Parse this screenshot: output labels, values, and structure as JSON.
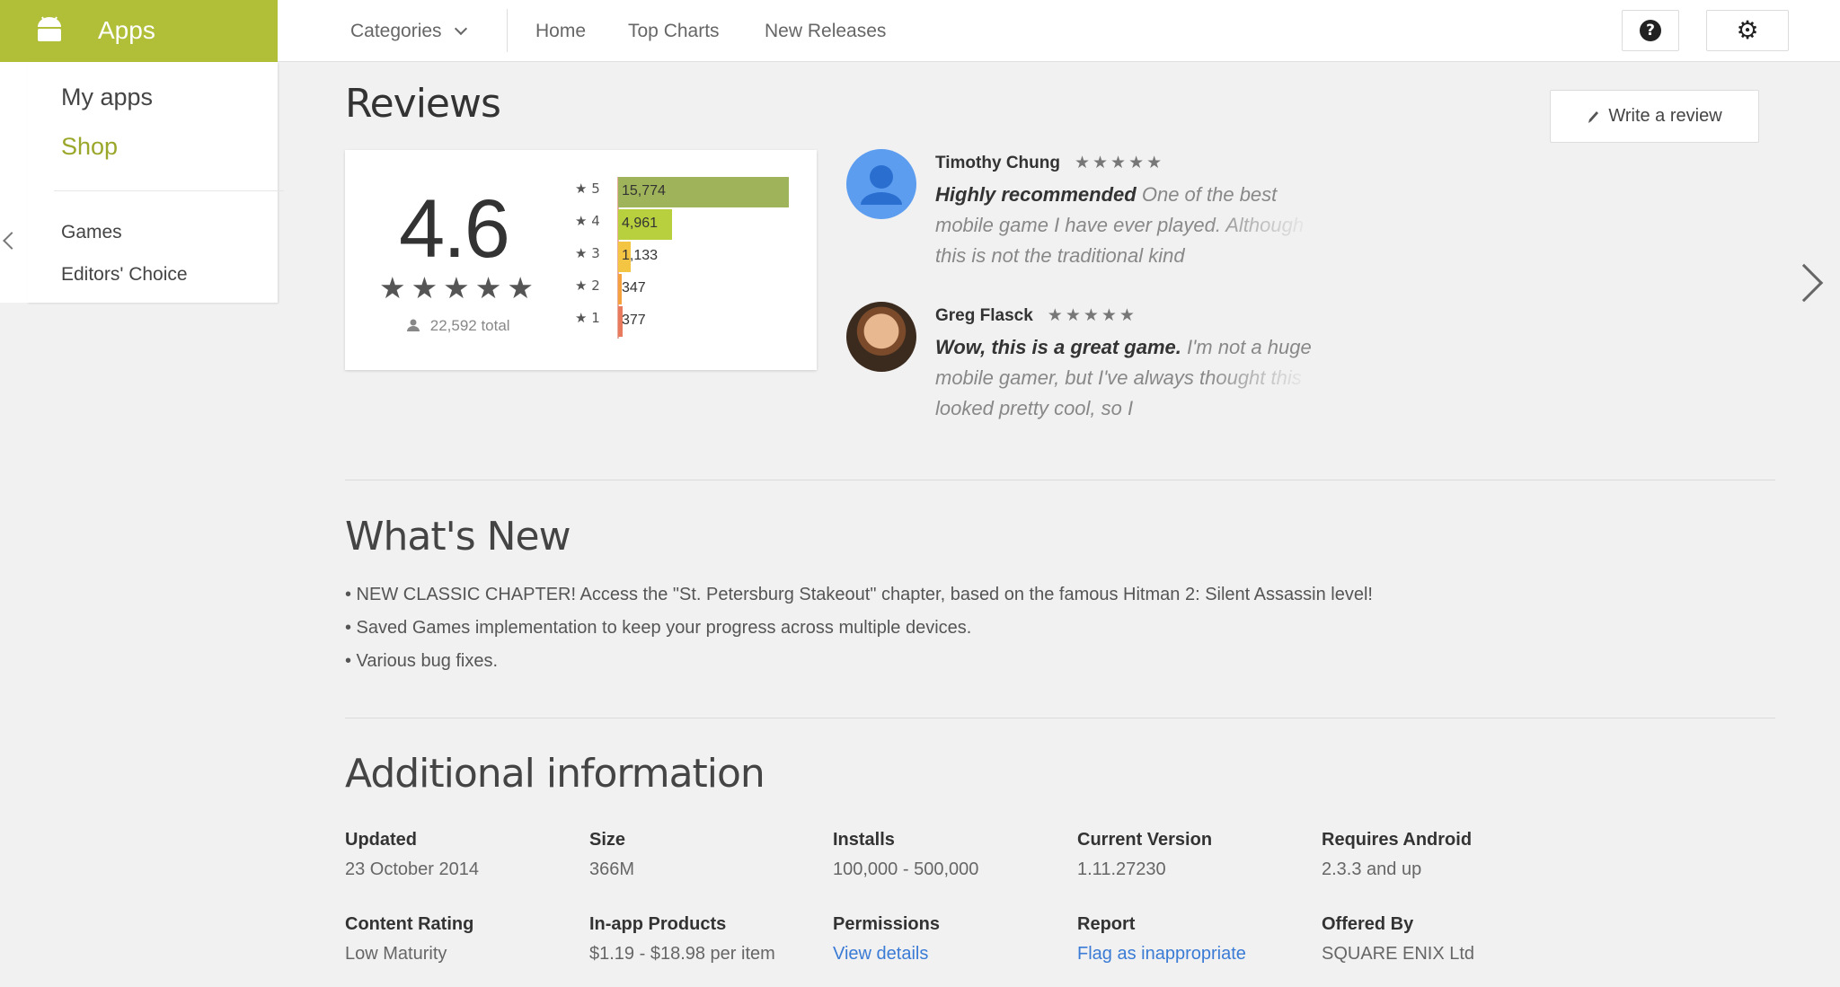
{
  "topbar": {
    "apps_label": "Apps",
    "nav": {
      "categories": "Categories",
      "home": "Home",
      "top_charts": "Top Charts",
      "new_releases": "New Releases"
    },
    "accent_color": "#b1bf38"
  },
  "sidebar": {
    "my_apps": "My apps",
    "shop": "Shop",
    "games": "Games",
    "editors_choice": "Editors' Choice"
  },
  "reviews": {
    "title": "Reviews",
    "write_review": "Write a review",
    "score": "4.6",
    "stars": "★★★★★",
    "total": "22,592 total",
    "histogram": [
      {
        "label": "★ 5",
        "count": "15,774",
        "value": 15774,
        "color": "#9fb45a"
      },
      {
        "label": "★ 4",
        "count": "4,961",
        "value": 4961,
        "color": "#b8cf3e"
      },
      {
        "label": "★ 3",
        "count": "1,133",
        "value": 1133,
        "color": "#f4c542"
      },
      {
        "label": "★ 2",
        "count": "347",
        "value": 347,
        "color": "#f4a13e"
      },
      {
        "label": "★ 1",
        "count": "377",
        "value": 377,
        "color": "#e87a5e"
      }
    ],
    "items": [
      {
        "name": "Timothy Chung",
        "stars": "★★★★★",
        "headline": "Highly recommended",
        "body": "One of the best mobile game I have ever played. Although this is not the traditional kind"
      },
      {
        "name": "Greg Flasck",
        "stars": "★★★★★",
        "headline": "Wow, this is a great game.",
        "body": "I'm not a huge mobile gamer, but I've always thought this looked pretty cool, so I"
      }
    ]
  },
  "whats_new": {
    "title": "What's New",
    "items": [
      "• NEW CLASSIC CHAPTER! Access the \"St. Petersburg Stakeout\" chapter, based on the famous Hitman 2: Silent Assassin level!",
      "• Saved Games implementation to keep your progress across multiple devices.",
      "• Various bug fixes."
    ]
  },
  "additional_info": {
    "title": "Additional information",
    "fields": [
      {
        "label": "Updated",
        "value": "23 October 2014"
      },
      {
        "label": "Size",
        "value": "366M"
      },
      {
        "label": "Installs",
        "value": "100,000 - 500,000"
      },
      {
        "label": "Current Version",
        "value": "1.11.27230"
      },
      {
        "label": "Requires Android",
        "value": "2.3.3 and up"
      },
      {
        "label": "Content Rating",
        "value": "Low Maturity"
      },
      {
        "label": "In-app Products",
        "value": "$1.19 - $18.98 per item"
      },
      {
        "label": "Permissions",
        "value": "View details"
      },
      {
        "label": "Report",
        "value": "Flag as inappropriate"
      },
      {
        "label": "Offered By",
        "value": "SQUARE ENIX Ltd"
      }
    ]
  }
}
